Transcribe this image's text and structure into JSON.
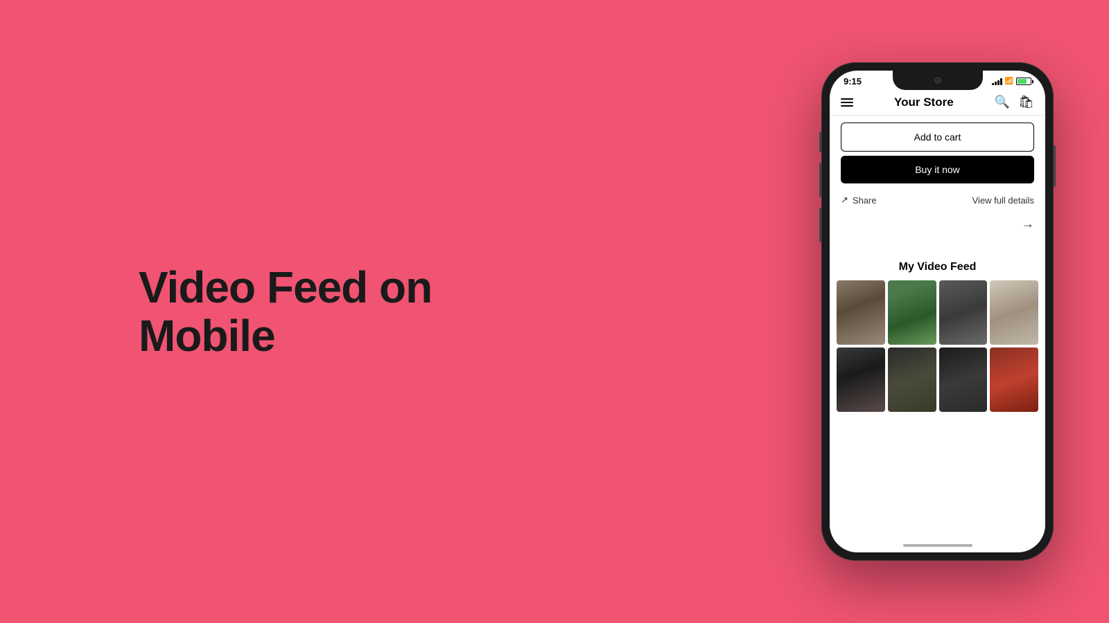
{
  "page": {
    "background_color": "#f05472",
    "heading": "Video Feed on Mobile"
  },
  "phone": {
    "status_bar": {
      "time": "9:15",
      "location_icon": "◀",
      "has_signal": true,
      "has_wifi": true,
      "has_battery": true
    },
    "navbar": {
      "title": "Your Store",
      "hamburger_label": "menu",
      "search_label": "search",
      "cart_label": "cart"
    },
    "buttons": {
      "add_to_cart": "Add to cart",
      "buy_it_now": "Buy it now"
    },
    "actions": {
      "share": "Share",
      "view_full_details": "View full details"
    },
    "video_feed": {
      "title": "My Video Feed",
      "thumbnails": [
        {
          "id": 1,
          "class": "thumb-1",
          "alt": "fashion video 1"
        },
        {
          "id": 2,
          "class": "thumb-2",
          "alt": "fashion video 2"
        },
        {
          "id": 3,
          "class": "thumb-3",
          "alt": "fashion video 3"
        },
        {
          "id": 4,
          "class": "thumb-4",
          "alt": "fashion video 4"
        },
        {
          "id": 5,
          "class": "thumb-5",
          "alt": "fashion video 5"
        },
        {
          "id": 6,
          "class": "thumb-6",
          "alt": "fashion video 6"
        },
        {
          "id": 7,
          "class": "thumb-7",
          "alt": "fashion video 7"
        },
        {
          "id": 8,
          "class": "thumb-8",
          "alt": "fashion video 8"
        }
      ]
    }
  }
}
